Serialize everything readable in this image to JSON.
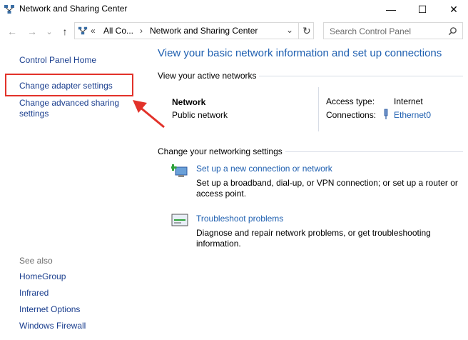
{
  "window": {
    "title": "Network and Sharing Center",
    "minimize_glyph": "—",
    "maximize_glyph": "☐",
    "close_glyph": "✕"
  },
  "nav": {
    "back_glyph": "←",
    "forward_glyph": "→",
    "recent_glyph": "⌄",
    "up_glyph": "↑",
    "address_prefix": "«",
    "breadcrumb": [
      "All Co...",
      "Network and Sharing Center"
    ],
    "breadcrumb_sep": "›",
    "dropdown_glyph": "⌄",
    "refresh_glyph": "↻"
  },
  "search": {
    "placeholder": "Search Control Panel",
    "icon": "search-icon"
  },
  "sidebar": {
    "links": [
      {
        "label": "Control Panel Home"
      },
      {
        "label": "Change adapter settings"
      },
      {
        "label": "Change advanced sharing\nsettings"
      }
    ],
    "see_also_title": "See also",
    "see_also": [
      {
        "label": "HomeGroup"
      },
      {
        "label": "Infrared"
      },
      {
        "label": "Internet Options"
      },
      {
        "label": "Windows Firewall"
      }
    ]
  },
  "main": {
    "title": "View your basic network information and set up connections",
    "active_networks_heading": "View your active networks",
    "network": {
      "name": "Network",
      "type": "Public network",
      "access_type_label": "Access type:",
      "access_type_value": "Internet",
      "connections_label": "Connections:",
      "connections_value": "Ethernet0"
    },
    "settings_heading": "Change your networking settings",
    "settings": [
      {
        "icon": "new-connection-icon",
        "link": "Set up a new connection or network",
        "desc": "Set up a broadband, dial-up, or VPN connection; or set up a router or access point."
      },
      {
        "icon": "troubleshoot-icon",
        "link": "Troubleshoot problems",
        "desc": "Diagnose and repair network problems, or get troubleshooting information."
      }
    ]
  },
  "colors": {
    "highlight_border": "#e2322a",
    "arrow": "#e2322a",
    "link": "#1e5fb0",
    "sidebar_link": "#1a3e8e"
  }
}
